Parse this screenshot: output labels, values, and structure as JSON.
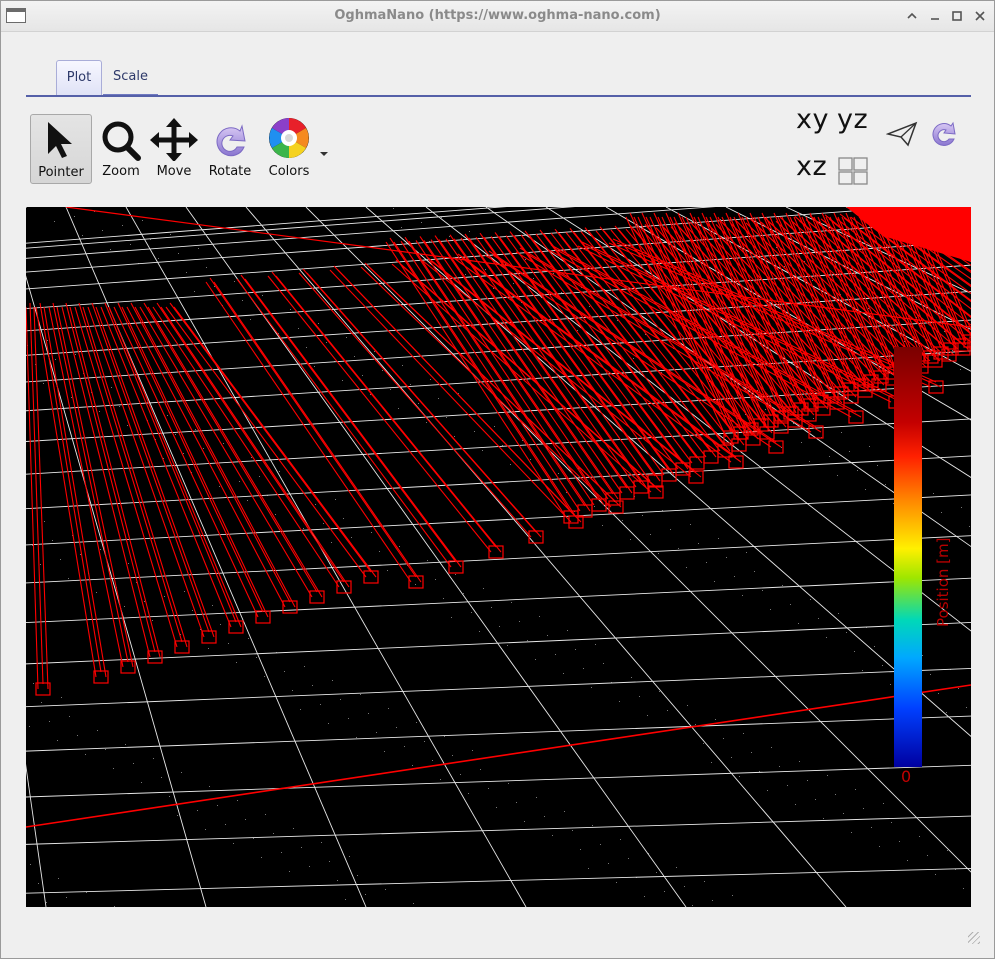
{
  "window": {
    "title": "OghmaNano (https://www.oghma-nano.com)",
    "controls": [
      "^",
      "–",
      "□",
      "✕"
    ]
  },
  "tabs": [
    {
      "label": "Plot",
      "active": true
    },
    {
      "label": "Scale",
      "active": false
    }
  ],
  "toolbar": {
    "tools": [
      {
        "label": "Pointer",
        "icon": "pointer-icon",
        "active": true
      },
      {
        "label": "Zoom",
        "icon": "zoom-icon"
      },
      {
        "label": "Move",
        "icon": "move-icon"
      },
      {
        "label": "Rotate",
        "icon": "rotate-icon"
      },
      {
        "label": "Colors",
        "icon": "color-wheel-icon"
      }
    ],
    "views": {
      "xy": "xy",
      "yz": "yz",
      "xz": "xz"
    },
    "right_icons": [
      "send-icon",
      "rotate-icon",
      "quad-view-icon"
    ]
  },
  "plot": {
    "background": "#000000",
    "wire_color": "#ff0000",
    "colorbar": {
      "title": "Position [m]",
      "min_label": "0"
    }
  }
}
